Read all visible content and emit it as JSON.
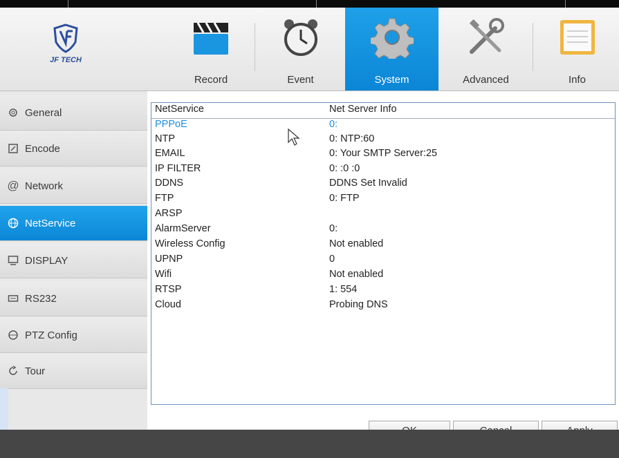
{
  "logo": {
    "brand": "JF TECH"
  },
  "tabs": [
    {
      "label": "Record",
      "icon": "record-clapper-icon",
      "active": false
    },
    {
      "label": "Event",
      "icon": "alarm-clock-icon",
      "active": false
    },
    {
      "label": "System",
      "icon": "gear-icon",
      "active": true
    },
    {
      "label": "Advanced",
      "icon": "tools-icon",
      "active": false
    },
    {
      "label": "Info",
      "icon": "info-window-icon",
      "active": false
    }
  ],
  "sidebar": {
    "items": [
      {
        "label": "General",
        "icon": "gear-outline-icon"
      },
      {
        "label": "Encode",
        "icon": "edit-icon"
      },
      {
        "label": "Network",
        "icon": "at-icon"
      },
      {
        "label": "NetService",
        "icon": "globe-icon",
        "active": true
      },
      {
        "label": "DISPLAY",
        "icon": "monitor-icon"
      },
      {
        "label": "RS232",
        "icon": "keyboard-icon"
      },
      {
        "label": "PTZ Config",
        "icon": "ptz-icon"
      },
      {
        "label": "Tour",
        "icon": "refresh-icon"
      }
    ]
  },
  "table": {
    "headers": [
      "NetService",
      "Net Server Info"
    ],
    "rows": [
      {
        "name": "PPPoE",
        "info": "0:"
      },
      {
        "name": "NTP",
        "info": "0: NTP:60"
      },
      {
        "name": "EMAIL",
        "info": "0: Your SMTP Server:25"
      },
      {
        "name": "IP FILTER",
        "info": "0: :0 :0"
      },
      {
        "name": "DDNS",
        "info": "DDNS Set Invalid"
      },
      {
        "name": "FTP",
        "info": "0: FTP"
      },
      {
        "name": "ARSP",
        "info": ""
      },
      {
        "name": "AlarmServer",
        "info": "0:"
      },
      {
        "name": "Wireless Config",
        "info": "Not enabled"
      },
      {
        "name": "UPNP",
        "info": "0"
      },
      {
        "name": "Wifi",
        "info": "Not enabled"
      },
      {
        "name": "RTSP",
        "info": "1: 554"
      },
      {
        "name": "Cloud",
        "info": "Probing DNS"
      }
    ],
    "selected_index": 0
  },
  "buttons": {
    "ok": "OK",
    "cancel": "Cancel",
    "apply": "Apply"
  },
  "colors": {
    "accent": "#0b86d6",
    "selected_text": "#1d8ee0"
  }
}
